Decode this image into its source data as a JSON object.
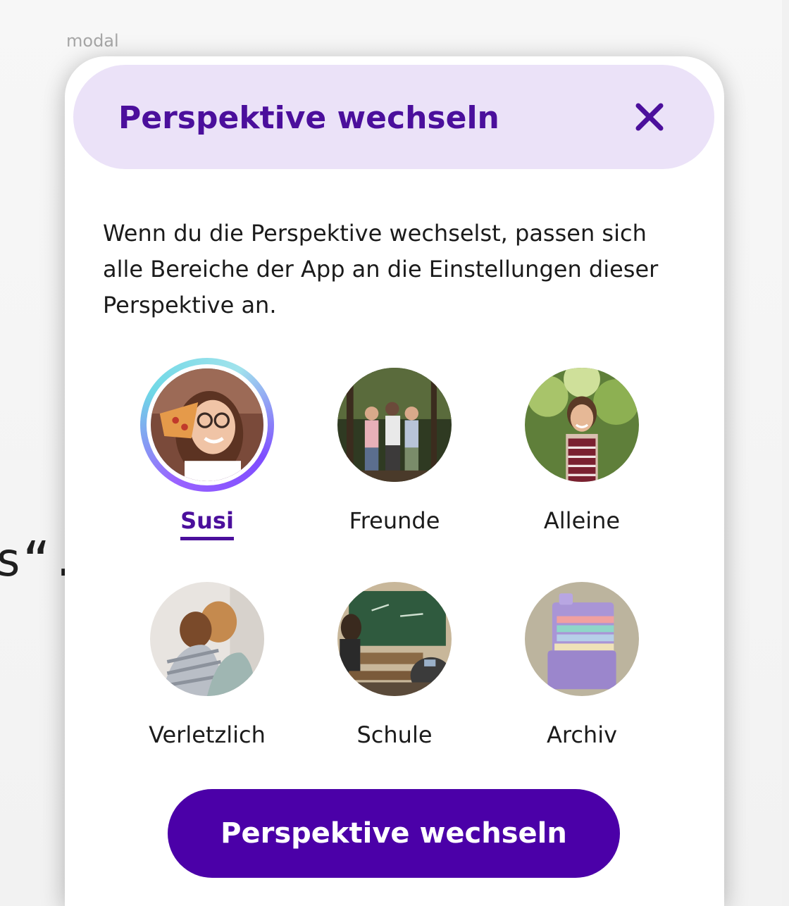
{
  "frame": {
    "label": "modal",
    "background_fragment": "s“."
  },
  "modal": {
    "title": "Perspektive wechseln",
    "close_icon": "close-icon",
    "intro": "Wenn du die Perspektive wechselst, passen sich alle Bereiche der App an die Einstellungen dieser Perspektive an.",
    "selected": "Susi",
    "perspectives": [
      {
        "label": "Susi",
        "image": "girl-with-pizza-photo",
        "selected": true
      },
      {
        "label": "Freunde",
        "image": "friends-in-forest-photo",
        "selected": false
      },
      {
        "label": "Alleine",
        "image": "girl-alone-photo",
        "selected": false
      },
      {
        "label": "Verletzlich",
        "image": "hugging-friends-photo",
        "selected": false
      },
      {
        "label": "Schule",
        "image": "classroom-photo",
        "selected": false
      },
      {
        "label": "Archiv",
        "image": "archive-folders-image",
        "selected": false
      }
    ],
    "cta_label": "Perspektive wechseln"
  },
  "colors": {
    "accent": "#4b0f9c",
    "button": "#4b00a8",
    "header_bg": "#ebe2f8",
    "ring_gradient": [
      "#9a63ff",
      "#6fd8e6"
    ]
  }
}
